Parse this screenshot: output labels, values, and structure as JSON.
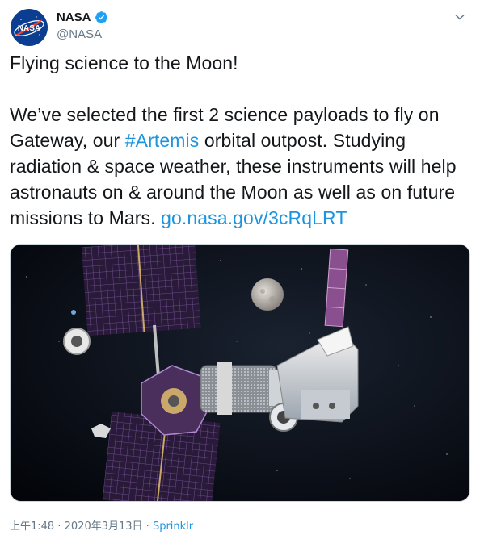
{
  "user": {
    "display_name": "NASA",
    "handle": "@NASA",
    "avatar_text": "NASA",
    "verified": true
  },
  "tweet": {
    "line1": "Flying science to the Moon!",
    "text_before_hashtag": "We’ve selected the first 2 science payloads to fly on Gateway, our ",
    "hashtag": "#Artemis",
    "text_after_hashtag": " orbital outpost. Studying radiation & space weather, these instruments will help astronauts on & around the Moon as well as on future missions to Mars. ",
    "link": "go.nasa.gov/3cRqLRT"
  },
  "meta": {
    "time": "上午1:48",
    "separator": "·",
    "date": "2020年3月13日",
    "source": "Sprinklr"
  },
  "colors": {
    "link": "#1b95e0",
    "verified": "#1da1f2",
    "secondary_text": "#657786"
  },
  "icons": {
    "verified": "verified-badge-icon",
    "menu": "chevron-down-icon"
  }
}
